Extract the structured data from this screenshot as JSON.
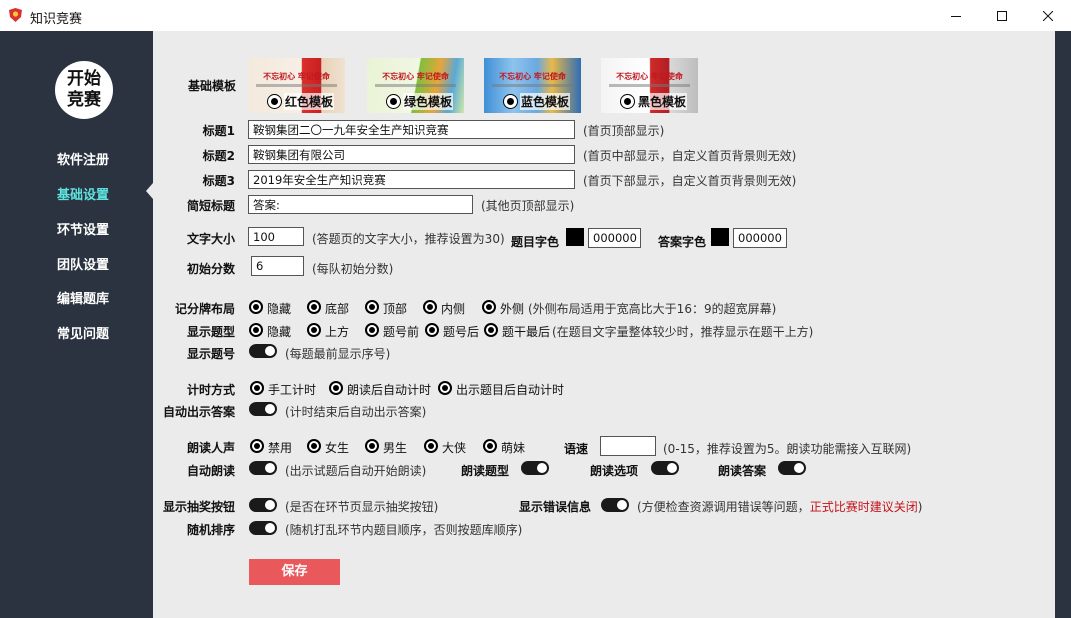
{
  "window": {
    "title": "知识竞赛"
  },
  "sidebar": {
    "logo": "开始\n竞赛",
    "items": [
      "软件注册",
      "基础设置",
      "环节设置",
      "团队设置",
      "编辑题库",
      "常见问题"
    ],
    "active_index": 1
  },
  "templates": {
    "label": "基础模板",
    "options": [
      {
        "name": "红色模板",
        "banner": "不忘初心 牢记使命",
        "color": "#c0181f"
      },
      {
        "name": "绿色模板",
        "banner": "不忘初心 牢记使命",
        "color": "#3aa33a"
      },
      {
        "name": "蓝色模板",
        "banner": "不忘初心 牢记使命",
        "color": "#2a72c4"
      },
      {
        "name": "黑色模板",
        "banner": "不忘初心 牢记使命",
        "color": "#555555"
      }
    ]
  },
  "titles": {
    "title1": {
      "label": "标题1",
      "value": "鞍钢集团二〇一九年安全生产知识竞赛",
      "hint": "(首页顶部显示)"
    },
    "title2": {
      "label": "标题2",
      "value": "鞍钢集团有限公司",
      "hint": "(首页中部显示，自定义首页背景则无效)"
    },
    "title3": {
      "label": "标题3",
      "value": "2019年安全生产知识竞赛",
      "hint": "(首页下部显示，自定义首页背景则无效)"
    },
    "short": {
      "label": "简短标题",
      "value": "答案:",
      "hint": "(其他页顶部显示)"
    }
  },
  "font": {
    "label": "文字大小",
    "value": "100",
    "hint": "(答题页的文字大小，推荐设置为30)",
    "q_color_label": "题目字色",
    "q_color_value": "000000",
    "a_color_label": "答案字色",
    "a_color_value": "000000"
  },
  "score": {
    "label": "初始分数",
    "value": "6",
    "hint": "(每队初始分数)"
  },
  "scoreboard": {
    "label": "记分牌布局",
    "options": [
      "隐藏",
      "底部",
      "顶部",
      "内侧",
      "外侧"
    ],
    "hint": "(外侧布局适用于宽高比大于16：9的超宽屏幕)"
  },
  "question_type": {
    "label": "显示题型",
    "options": [
      "隐藏",
      "上方",
      "题号前",
      "题号后",
      "题干最后"
    ],
    "hint": "(在题目文字量整体较少时，推荐显示在题干上方)"
  },
  "show_number": {
    "label": "显示题号",
    "hint": "(每题最前显示序号)"
  },
  "timer": {
    "label": "计时方式",
    "options": [
      "手工计时",
      "朗读后自动计时",
      "出示题目后自动计时"
    ]
  },
  "auto_answer": {
    "label": "自动出示答案",
    "hint": "(计时结束后自动出示答案)"
  },
  "voice": {
    "label": "朗读人声",
    "options": [
      "禁用",
      "女生",
      "男生",
      "大侠",
      "萌妹"
    ],
    "speed_label": "语速",
    "speed_value": "",
    "hint": "(0-15，推荐设置为5。朗读功能需接入互联网)"
  },
  "auto_read": {
    "label": "自动朗读",
    "hint": "(出示试题后自动开始朗读)",
    "read_type_label": "朗读题型",
    "read_options_label": "朗读选项",
    "read_answer_label": "朗读答案"
  },
  "lottery": {
    "label": "显示抽奖按钮",
    "hint": "(是否在环节页显示抽奖按钮)"
  },
  "errors": {
    "label": "显示错误信息",
    "hint_prefix": "(方便检查资源调用错误等问题，",
    "hint_red": "正式比赛时建议关闭",
    "hint_suffix": ")"
  },
  "random": {
    "label": "随机排序",
    "hint": "(随机打乱环节内题目顺序，否则按题库顺序)"
  },
  "save_label": "保存"
}
